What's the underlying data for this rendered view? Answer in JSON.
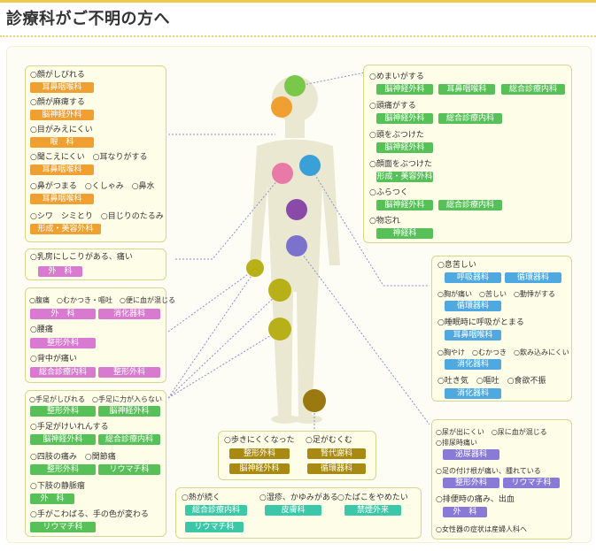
{
  "header": {
    "title": "診療科がご不明の方へ"
  },
  "left_top_box": {
    "items": [
      {
        "text": "○顔がしびれる",
        "dept": "耳鼻咽喉科"
      },
      {
        "text": "○顔が麻痺する",
        "dept": "脳神経外科"
      },
      {
        "text": "○目がみえにくい",
        "dept": "眼　科"
      },
      {
        "text": "○聞こえにくい　○耳なりがする",
        "dept": "耳鼻咽喉科"
      },
      {
        "text": "○鼻がつまる　○くしゃみ　○鼻水",
        "dept": "耳鼻咽喉科"
      },
      {
        "text": "○シワ　シミとり　○目じりのたるみ",
        "dept": "形成・美容外科"
      }
    ]
  },
  "breast_box": {
    "text": "○乳房にしこりがある、痛い",
    "dept": "外　科"
  },
  "abdomen_box": {
    "items": [
      {
        "text": "○腹痛　○むかつき・嘔吐　○便に血が混じる",
        "depts": [
          "外　科",
          "消化器科"
        ]
      },
      {
        "text": "○腰痛",
        "depts": [
          "整形外科"
        ]
      },
      {
        "text": "○背中が痛い",
        "depts": [
          "総合診療内科",
          "整形外科"
        ]
      }
    ]
  },
  "limbs_box": {
    "items": [
      {
        "text": "○手足がしびれる　○手足に力が入らない",
        "depts": [
          "整形外科",
          "脳神経外科"
        ]
      },
      {
        "text": "○手足がけいれんする",
        "depts": [
          "脳神経外科",
          "総合診療内科"
        ]
      },
      {
        "text": "○四肢の痛み　○関節痛",
        "depts": [
          "整形外科",
          "リウマチ科"
        ]
      },
      {
        "text": "○下肢の静脈瘤",
        "depts": [
          "外　科"
        ]
      },
      {
        "text": "○手がこわばる、手の色が変わる",
        "depts": [
          "リウマチ科"
        ]
      }
    ]
  },
  "head_box": {
    "items": [
      {
        "text": "○めまいがする",
        "depts": [
          "脳神経外科",
          "耳鼻咽喉科",
          "総合診療内科"
        ]
      },
      {
        "text": "○頭痛がする",
        "depts": [
          "脳神経外科",
          "総合診療内科"
        ]
      },
      {
        "text": "○頭をぶつけた",
        "depts": [
          "脳神経外科"
        ]
      },
      {
        "text": "○顔面をぶつけた",
        "depts": [
          "形成・美容外科"
        ]
      },
      {
        "text": "○ふらつく",
        "depts": [
          "脳神経外科",
          "総合診療内科"
        ]
      },
      {
        "text": "○物忘れ",
        "depts": [
          "神経科"
        ]
      }
    ]
  },
  "chest_box": {
    "items": [
      {
        "text": "○息苦しい",
        "depts": [
          "呼吸器科",
          "循環器科"
        ]
      },
      {
        "text": "○胸が痛い　○苦しい　○動悸がする",
        "depts": [
          "循環器科"
        ]
      },
      {
        "text": "○睡眠時に呼吸がとまる",
        "depts": [
          "耳鼻咽喉科"
        ]
      },
      {
        "text": "○胸やけ　○むかつき　○飲み込みにくい",
        "depts": [
          "消化器科"
        ]
      },
      {
        "text": "○吐き気　○嘔吐　○食欲不振",
        "depts": [
          "消化器科"
        ]
      }
    ]
  },
  "lower_right_box": {
    "items": [
      {
        "text": "○尿が出にくい　○尿に血が混じる",
        "depts": []
      },
      {
        "text": "○排尿時痛い",
        "depts": [
          "泌尿器科"
        ]
      },
      {
        "text": "○足の付け根が痛い、腫れている",
        "depts": [
          "整形外科",
          "リウマチ科"
        ]
      },
      {
        "text": "○排便時の痛み、出血",
        "depts": [
          "外　科"
        ]
      },
      {
        "text": "○女性器の症状は産婦人科へ",
        "depts": []
      }
    ]
  },
  "feet_box": {
    "items": [
      {
        "text": "○歩きにくくなった",
        "depts": [
          "整形外科",
          "脳神経外科"
        ]
      },
      {
        "text": "○足がむくむ",
        "depts": [
          "腎代謝科",
          "循環器科"
        ]
      }
    ]
  },
  "general_box": {
    "items": [
      {
        "text": "○熱が続く",
        "depts": [
          "総合診療内科",
          "リウマチ科"
        ]
      },
      {
        "text": "○湿疹、かゆみがある",
        "depts": [
          "皮膚科"
        ]
      },
      {
        "text": "○たばこをやめたい",
        "depts": [
          "禁煙外来"
        ]
      }
    ]
  },
  "colors": {
    "orange": "#f0a030",
    "green": "#58c058",
    "pink": "#d87ad0",
    "blue": "#50a8e0",
    "purple": "#8a7ad8",
    "olive": "#a88a12",
    "teal": "#3cc8a8",
    "box_border": "#d7d68f",
    "body_silhouette": "#ebe8d2"
  },
  "body_markers": [
    {
      "name": "head-top",
      "color": "#7ac84a"
    },
    {
      "name": "face",
      "color": "#f0a030"
    },
    {
      "name": "breast",
      "color": "#e87aa8"
    },
    {
      "name": "chest",
      "color": "#3aa0d8"
    },
    {
      "name": "stomach",
      "color": "#8a4aa8"
    },
    {
      "name": "lower-abdomen",
      "color": "#7a72cc"
    },
    {
      "name": "hand",
      "color": "#b8b018"
    },
    {
      "name": "hip",
      "color": "#b8b018"
    },
    {
      "name": "thigh",
      "color": "#b8b018"
    },
    {
      "name": "foot",
      "color": "#9a7a10"
    }
  ]
}
